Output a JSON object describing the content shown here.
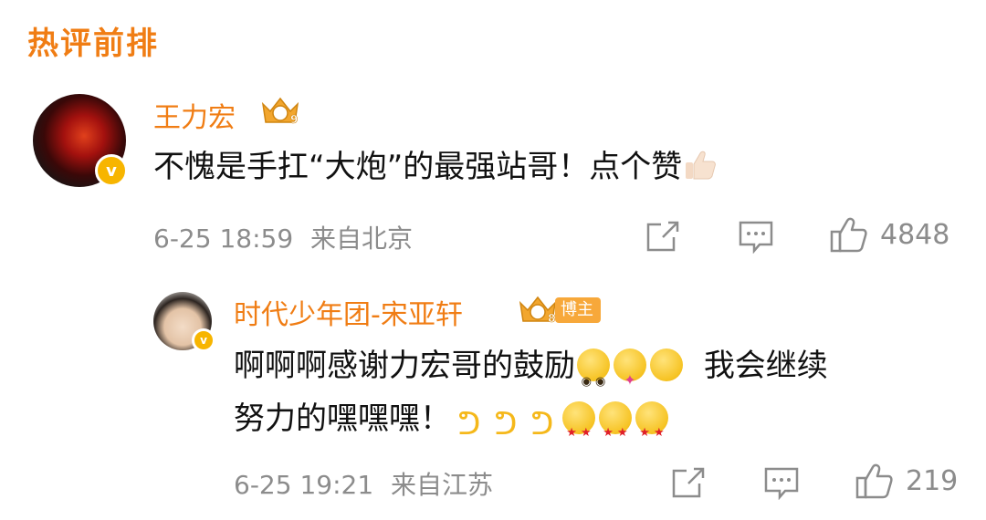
{
  "section": {
    "title": "热评前排"
  },
  "comment": {
    "username": "王力宏",
    "level": "9",
    "text_before": "不愧是手扛“大炮”的最强站哥！点个赞",
    "emoji": "thumbs-up",
    "date": "6-25 18:59",
    "location": "来自北京",
    "likes": "4848"
  },
  "reply": {
    "username": "时代少年团-宋亚轩",
    "level": "8",
    "role_badge": "博主",
    "line1_text": "啊啊啊感谢力宏哥的鼓励",
    "line1_tail": "我会继续",
    "line2_text": "努力的嘿嘿嘿！",
    "emojis_line1": [
      "pleading-face",
      "partying-face",
      "grinning-face"
    ],
    "emojis_line2": [
      "flexed-biceps",
      "flexed-biceps",
      "flexed-biceps",
      "star-struck",
      "star-struck",
      "star-struck"
    ],
    "date": "6-25 19:21",
    "location": "来自江苏",
    "likes": "219"
  },
  "colors": {
    "accent": "#f07d14",
    "verified": "#f7b500",
    "meta_gray": "#8c8c8c",
    "text": "#111111"
  }
}
